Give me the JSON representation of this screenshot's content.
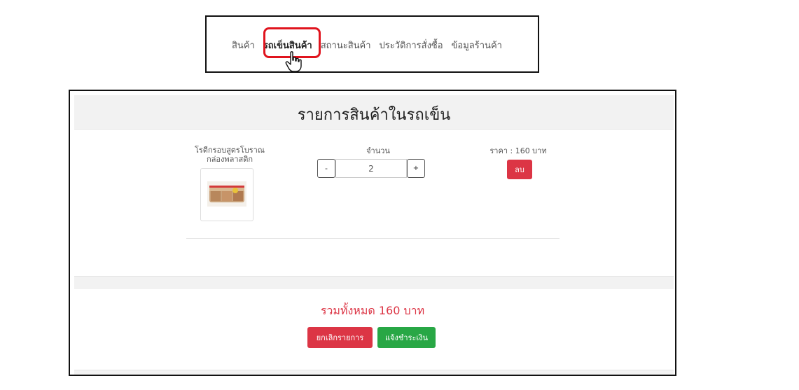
{
  "nav": {
    "items": [
      {
        "label": "สินค้า"
      },
      {
        "label": "รถเข็นสินค้า",
        "active": true
      },
      {
        "label": "สถานะสินค้า"
      },
      {
        "label": "ประวัติการสั่งซื้อ"
      },
      {
        "label": "ข้อมูลร้านค้า"
      }
    ],
    "highlight_color": "#e0141e"
  },
  "cart": {
    "title": "รายการสินค้าในรถเข็น",
    "item": {
      "name": "โรตีกรอบสูตรโบราณ กล่องพลาสติก",
      "qty_label": "จำนวน",
      "minus_label": "-",
      "quantity": "2",
      "plus_label": "+",
      "price_label": "ราคา : 160 บาท",
      "delete_label": "ลบ"
    },
    "total": "รวมทั้งหมด 160 บาท",
    "cancel_label": "ยกเลิกรายการ",
    "pay_label": "แจ้งชำระเงิน"
  },
  "colors": {
    "danger": "#dc3545",
    "success": "#28a745"
  }
}
